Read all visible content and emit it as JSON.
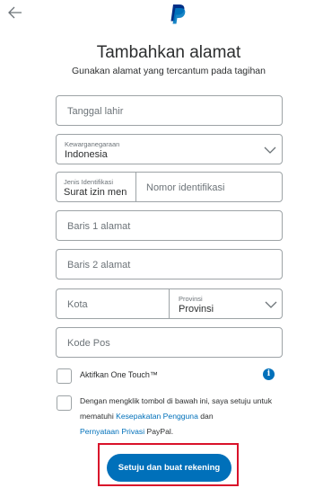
{
  "header": {
    "back_icon": "arrow-left-icon",
    "logo_icon": "paypal-logo-icon",
    "title": "Tambahkan alamat",
    "subtitle": "Gunakan alamat yang tercantum pada tagihan"
  },
  "form": {
    "birth_date_placeholder": "Tanggal lahir",
    "nationality": {
      "label": "Kewarganegaraan",
      "value": "Indonesia",
      "icon": "chevron-down-icon"
    },
    "id_type": {
      "label": "Jenis Identifikasi",
      "value": "Surat izin men"
    },
    "id_number_placeholder": "Nomor identifikasi",
    "address1_placeholder": "Baris 1 alamat",
    "address2_placeholder": "Baris 2 alamat",
    "city_placeholder": "Kota",
    "province": {
      "label": "Provinsi",
      "value": "Provinsi",
      "icon": "chevron-down-icon"
    },
    "postal_code_placeholder": "Kode Pos"
  },
  "one_touch": {
    "label": "Aktifkan One Touch™",
    "info_icon": "info-icon",
    "info_glyph": "i"
  },
  "agreement": {
    "text_before": "Dengan mengklik tombol di bawah ini, saya setuju untuk mematuhi ",
    "link_user_agreement": "Kesepakatan Pengguna",
    "text_middle": " dan ",
    "link_privacy": "Pernyataan Privasi",
    "text_after": " PayPal."
  },
  "submit_label": "Setuju dan buat rekening",
  "colors": {
    "accent": "#0070ba",
    "highlight": "#d9122a",
    "border": "#9da3a6"
  }
}
